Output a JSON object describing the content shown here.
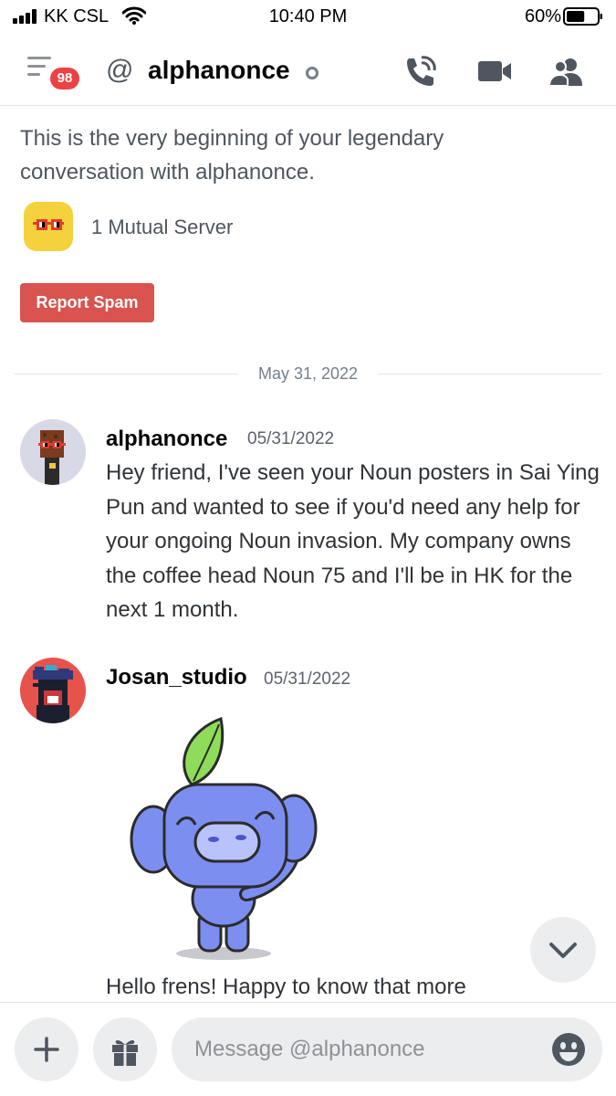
{
  "status_bar": {
    "carrier": "KK CSL",
    "time": "10:40 PM",
    "battery_percent": "60%",
    "battery_level": 0.6
  },
  "header": {
    "unread_badge": "98",
    "channel_name": "alphanonce",
    "icons": [
      "menu-icon",
      "at-icon",
      "call-icon",
      "video-icon",
      "members-icon"
    ]
  },
  "intro": {
    "text": "This is the very beginning of your legendary conversation with alphanonce.",
    "mutual_servers": "1 Mutual Server",
    "report_spam": "Report Spam"
  },
  "date_divider": "May 31, 2022",
  "messages": [
    {
      "author": "alphanonce",
      "timestamp": "05/31/2022",
      "text": "Hey friend, I've seen your Noun posters in Sai Ying Pun and wanted to see if you'd need any help for your ongoing Noun invasion. My company owns the coffee head Noun 75 and I'll be in HK for the next 1 month."
    },
    {
      "author": "Josan_studio",
      "timestamp": "05/31/2022",
      "text": "Hello frens! Happy to know that more"
    }
  ],
  "composer": {
    "placeholder": "Message @alphanonce"
  },
  "colors": {
    "badge": "#ed4245",
    "report_button": "#d9534f",
    "mutual_server_icon": "#f4d23d",
    "wumpus": "#7c8ef0",
    "leaf": "#8fdc5a"
  }
}
